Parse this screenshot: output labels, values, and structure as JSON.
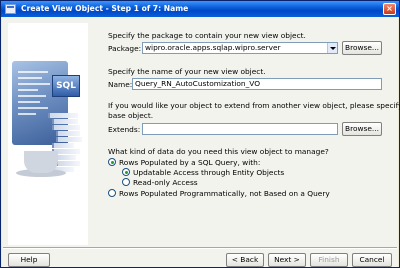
{
  "window": {
    "title": "Create View Object - Step 1 of 7: Name"
  },
  "package": {
    "prompt": "Specify the package to contain your new view object.",
    "label": "Package:",
    "value": "wipro.oracle.apps.sqlap.wipro.server",
    "browse_label": "Browse..."
  },
  "name": {
    "prompt": "Specify the name of your new view object.",
    "label": "Name:",
    "value": "Query_RN_AutoCustomization_VO"
  },
  "extends": {
    "prompt_line1": "If you would like your object to extend from another view object, please specify the",
    "prompt_line2": "base object.",
    "label": "Extends:",
    "value": "",
    "browse_label": "Browse..."
  },
  "data_source": {
    "question": "What kind of data do you need this view object to manage?",
    "options": [
      {
        "label": "Rows Populated by a SQL Query, with:",
        "selected": true
      },
      {
        "label": "Updatable Access through Entity Objects",
        "selected": true
      },
      {
        "label": "Read-only Access",
        "selected": false
      },
      {
        "label": "Rows Populated Programmatically, not Based on a Query",
        "selected": false
      }
    ]
  },
  "art": {
    "label": "SQL"
  },
  "footer": {
    "help": "Help",
    "back": "< Back",
    "next": "Next >",
    "finish": "Finish",
    "cancel": "Cancel"
  }
}
